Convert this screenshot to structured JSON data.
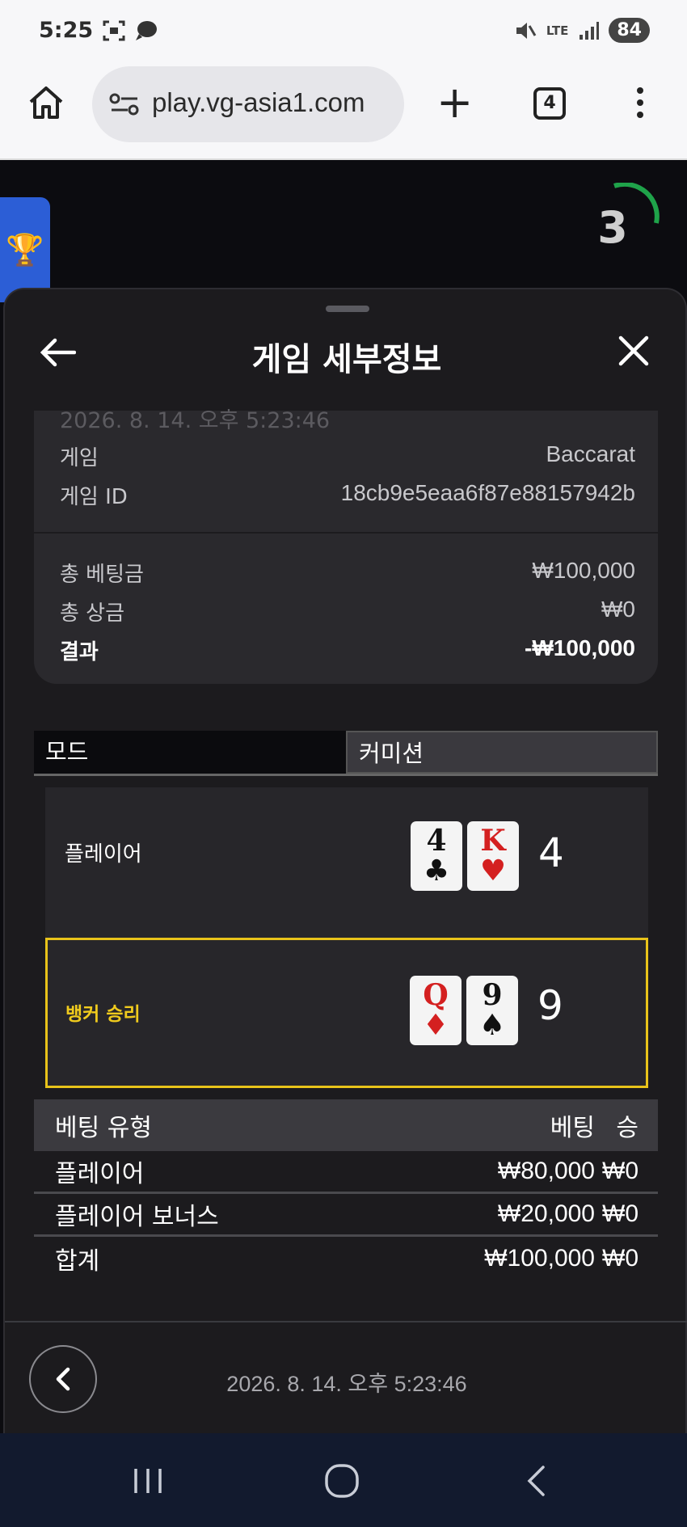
{
  "status_bar": {
    "time": "5:25",
    "network": "LTE",
    "battery": "84"
  },
  "browser": {
    "url": "play.vg-asia1.com",
    "tab_count": "4"
  },
  "game": {
    "countdown": "3"
  },
  "sheet": {
    "title": "게임 세부정보",
    "faded_date": "2026. 8. 14. 오후 5:23:46",
    "info": [
      {
        "label": "게임",
        "value": "Baccarat"
      },
      {
        "label": "게임 ID",
        "value": "18cb9e5eaa6f87e88157942b"
      }
    ],
    "money": [
      {
        "label": "총 베팅금",
        "value": "₩100,000"
      },
      {
        "label": "총 상금",
        "value": "₩0"
      },
      {
        "label": "결과",
        "value": "-₩100,000"
      }
    ],
    "mode_tabs": [
      "모드",
      "커미션"
    ],
    "player": {
      "label": "플레이어",
      "cards": [
        {
          "rank": "4",
          "suit": "♣"
        },
        {
          "rank": "K",
          "suit": "♥"
        }
      ],
      "score": "4"
    },
    "banker": {
      "label": "뱅커 승리",
      "cards": [
        {
          "rank": "Q",
          "suit": "♦"
        },
        {
          "rank": "9",
          "suit": "♠"
        }
      ],
      "score": "9"
    },
    "bets": {
      "headers": [
        "베팅 유형",
        "베팅",
        "승"
      ],
      "rows": [
        [
          "플레이어",
          "₩80,000",
          "₩0"
        ],
        [
          "플레이어 보너스",
          "₩20,000",
          "₩0"
        ],
        [
          "합계",
          "₩100,000",
          "₩0"
        ]
      ]
    },
    "footer_date": "2026. 8. 14. 오후 5:23:46"
  },
  "colors": {
    "banker_highlight": "#e8c31a",
    "countdown_ring": "#1fa34a",
    "trophy_tab": "#2c5ed6",
    "sheet_bg": "#1c1b1e",
    "nav_bg": "#121a2e"
  }
}
